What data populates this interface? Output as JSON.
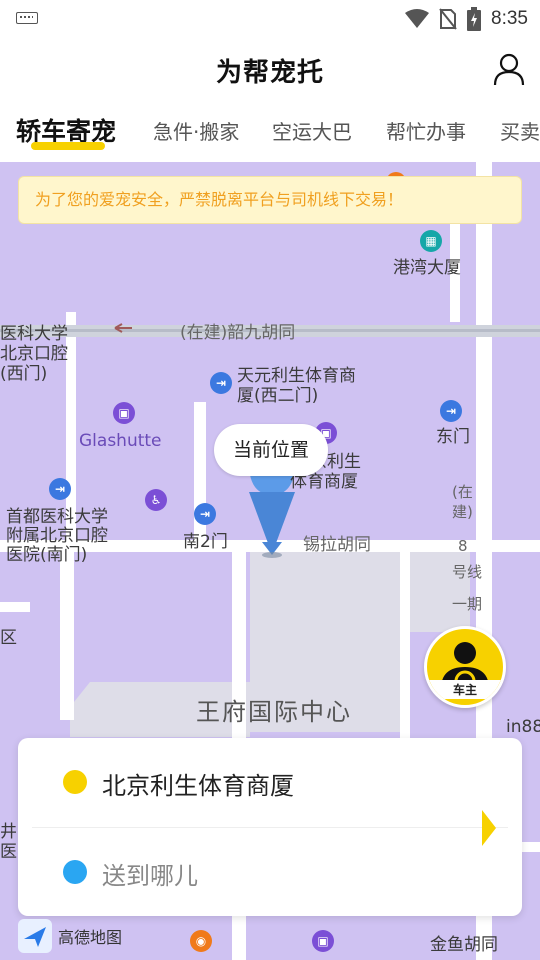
{
  "status_bar": {
    "time": "8:35"
  },
  "header": {
    "title": "为帮宠托"
  },
  "tabs": [
    {
      "label": "轿车寄宠"
    },
    {
      "label": "急件·搬家"
    },
    {
      "label": "空运大巴"
    },
    {
      "label": "帮忙办事"
    },
    {
      "label": "买卖"
    }
  ],
  "banner": {
    "text": "为了您的爱宠安全，严禁脱离平台与司机线下交易！"
  },
  "map": {
    "labels": {
      "gangwan": "港湾大厦",
      "school_west_1": "医科大学",
      "school_west_2": "北京口腔",
      "school_west_3": "(西门)",
      "road_north": "(在建)韶九胡同",
      "tianyuan_1": "天元利生体育商",
      "tianyuan_2": "厦(西二门)",
      "glashutte": "Glashutte",
      "east_gate": "东门",
      "lisheng_1": "京利生",
      "lisheng_2": "体育商厦",
      "shoudu_1": "首都医科大学",
      "shoudu_2": "附属北京口腔",
      "shoudu_3": "医院(南门)",
      "south_gate2": "南2门",
      "xila_road": "锡拉胡同",
      "line8_1": "(在",
      "line8_2": "建)",
      "line8_3": "8",
      "line8_4": "号线",
      "line8_5": "一期",
      "district": "区",
      "wangfu": "王府国际中心",
      "in88": "in88",
      "jing": "井",
      "yiyuan": "医院",
      "jinyu": "金鱼胡同"
    },
    "current_location": "当前位置",
    "driver_button": "车主",
    "logo": "高德地图"
  },
  "route": {
    "from": "北京利生体育商厦",
    "to_placeholder": "送到哪儿"
  },
  "colors": {
    "accent": "#f7d100",
    "from_dot": "#f7d100",
    "to_dot": "#2aa6f2",
    "map_bg": "#cfc2f2",
    "banner_text": "#f0a020"
  }
}
